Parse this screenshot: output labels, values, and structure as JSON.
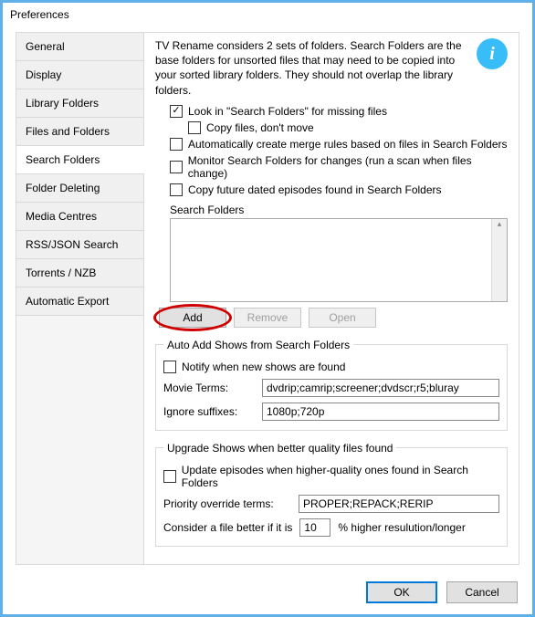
{
  "window": {
    "title": "Preferences"
  },
  "tabs": [
    {
      "label": "General"
    },
    {
      "label": "Display"
    },
    {
      "label": "Library Folders"
    },
    {
      "label": "Files and Folders"
    },
    {
      "label": "Search Folders",
      "active": true
    },
    {
      "label": "Folder Deleting"
    },
    {
      "label": "Media Centres"
    },
    {
      "label": "RSS/JSON Search"
    },
    {
      "label": "Torrents / NZB"
    },
    {
      "label": "Automatic Export"
    }
  ],
  "info": "TV Rename considers 2 sets of folders. Search Folders are the base folders for unsorted files that may need to be copied into your sorted library folders. They should not overlap the library folders.",
  "checkboxes": {
    "look_in": {
      "label": "Look in \"Search Folders\" for missing files",
      "checked": true
    },
    "copy_dont_move": {
      "label": "Copy files, don't move",
      "checked": false
    },
    "auto_merge": {
      "label": "Automatically create merge rules based on files in Search Folders",
      "checked": false
    },
    "monitor": {
      "label": "Monitor Search Folders for changes (run a scan when files change)",
      "checked": false
    },
    "copy_future": {
      "label": "Copy future dated episodes found in Search Folders",
      "checked": false
    }
  },
  "search_folders_label": "Search Folders",
  "buttons": {
    "add": "Add",
    "remove": "Remove",
    "open": "Open"
  },
  "auto_add": {
    "legend": "Auto Add Shows from Search Folders",
    "notify": {
      "label": "Notify when new shows are found",
      "checked": false
    },
    "movie_terms_label": "Movie Terms:",
    "movie_terms_value": "dvdrip;camrip;screener;dvdscr;r5;bluray",
    "ignore_suffixes_label": "Ignore suffixes:",
    "ignore_suffixes_value": "1080p;720p"
  },
  "upgrade": {
    "legend": "Upgrade Shows when better quality files found",
    "update": {
      "label": "Update episodes when higher-quality ones found in Search Folders",
      "checked": false
    },
    "priority_label": "Priority override terms:",
    "priority_value": "PROPER;REPACK;RERIP",
    "consider_prefix": "Consider a file better if it is",
    "consider_value": "10",
    "consider_suffix": "% higher resulution/longer"
  },
  "dialog": {
    "ok": "OK",
    "cancel": "Cancel"
  }
}
